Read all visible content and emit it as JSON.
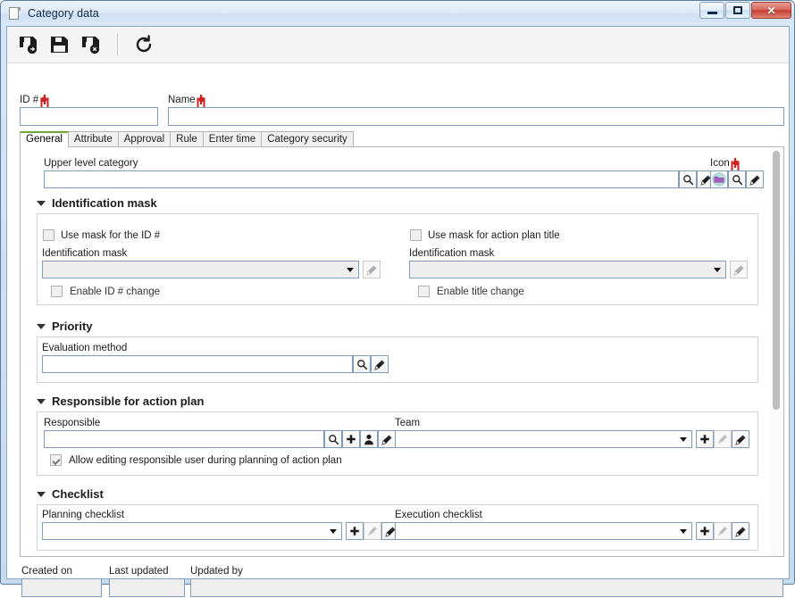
{
  "window": {
    "title": "Category data",
    "icon": "document-icon",
    "controls": {
      "minimize": "Minimize",
      "restore": "Restore",
      "close": "Close"
    }
  },
  "toolbar": {
    "buttons": [
      {
        "name": "save-and-new-button",
        "icon": "save-new-icon",
        "title": "Save and create new"
      },
      {
        "name": "save-button",
        "icon": "save-icon",
        "title": "Save"
      },
      {
        "name": "save-and-close-button",
        "icon": "save-close-icon",
        "title": "Save and close"
      },
      {
        "name": "refresh-button",
        "icon": "refresh-icon",
        "title": "Refresh"
      }
    ]
  },
  "header_fields": {
    "id": {
      "label": "ID #",
      "value": "",
      "required": true
    },
    "name": {
      "label": "Name",
      "value": "",
      "required": true
    }
  },
  "tabs": [
    {
      "label": "General",
      "active": true
    },
    {
      "label": "Attribute",
      "active": false
    },
    {
      "label": "Approval",
      "active": false
    },
    {
      "label": "Rule",
      "active": false
    },
    {
      "label": "Enter time",
      "active": false
    },
    {
      "label": "Category security",
      "active": false
    }
  ],
  "general": {
    "upper_level": {
      "label": "Upper level category",
      "value": "",
      "search_icon": "magnifier-icon",
      "clear_icon": "brush-icon"
    },
    "icon_field": {
      "label": "Icon",
      "required": true,
      "preview_icon": "folder-icon",
      "search_icon": "magnifier-icon",
      "clear_icon": "brush-icon"
    },
    "sections": {
      "identification_mask": {
        "title": "Identification mask",
        "expanded": true,
        "left": {
          "use_mask_label": "Use mask for the ID #",
          "use_mask_checked": false,
          "mask_label": "Identification mask",
          "mask_value": "",
          "mask_disabled": true,
          "enable_change_label": "Enable ID # change",
          "enable_change_checked": false,
          "clear_icon": "brush-icon"
        },
        "right": {
          "use_mask_label": "Use mask for action plan title",
          "use_mask_checked": false,
          "mask_label": "Identification mask",
          "mask_value": "",
          "mask_disabled": true,
          "enable_change_label": "Enable title change",
          "enable_change_checked": false,
          "clear_icon": "brush-icon"
        }
      },
      "priority": {
        "title": "Priority",
        "expanded": true,
        "evaluation_method": {
          "label": "Evaluation method",
          "value": "",
          "search_icon": "magnifier-icon",
          "clear_icon": "brush-icon"
        }
      },
      "responsible": {
        "title": "Responsible for action plan",
        "expanded": true,
        "responsible_field": {
          "label": "Responsible",
          "value": "",
          "search_icon": "magnifier-icon",
          "add_icon": "plus-icon",
          "user_icon": "person-icon",
          "clear_icon": "brush-icon"
        },
        "team_field": {
          "label": "Team",
          "value": "",
          "add_icon": "plus-icon",
          "edit_icon": "pencil-icon",
          "edit_disabled": true,
          "clear_icon": "brush-icon"
        },
        "allow_editing_label": "Allow editing responsible user during planning of action plan",
        "allow_editing_checked": true
      },
      "checklist": {
        "title": "Checklist",
        "expanded": true,
        "planning": {
          "label": "Planning checklist",
          "value": "",
          "add_icon": "plus-icon",
          "edit_icon": "pencil-icon",
          "edit_disabled": true,
          "clear_icon": "brush-icon"
        },
        "execution": {
          "label": "Execution checklist",
          "value": "",
          "add_icon": "plus-icon",
          "edit_icon": "pencil-icon",
          "edit_disabled": true,
          "clear_icon": "brush-icon"
        }
      }
    }
  },
  "footer": {
    "created_on": {
      "label": "Created on",
      "value": ""
    },
    "last_updated": {
      "label": "Last updated",
      "value": ""
    },
    "updated_by": {
      "label": "Updated by",
      "value": ""
    }
  },
  "scrollbar": {
    "name": "vertical-scrollbar"
  },
  "colors": {
    "accent_green": "#6ea832",
    "required_red": "#cc2222",
    "frame_blue": "#8ba7c2",
    "field_border": "#7f9db9"
  }
}
